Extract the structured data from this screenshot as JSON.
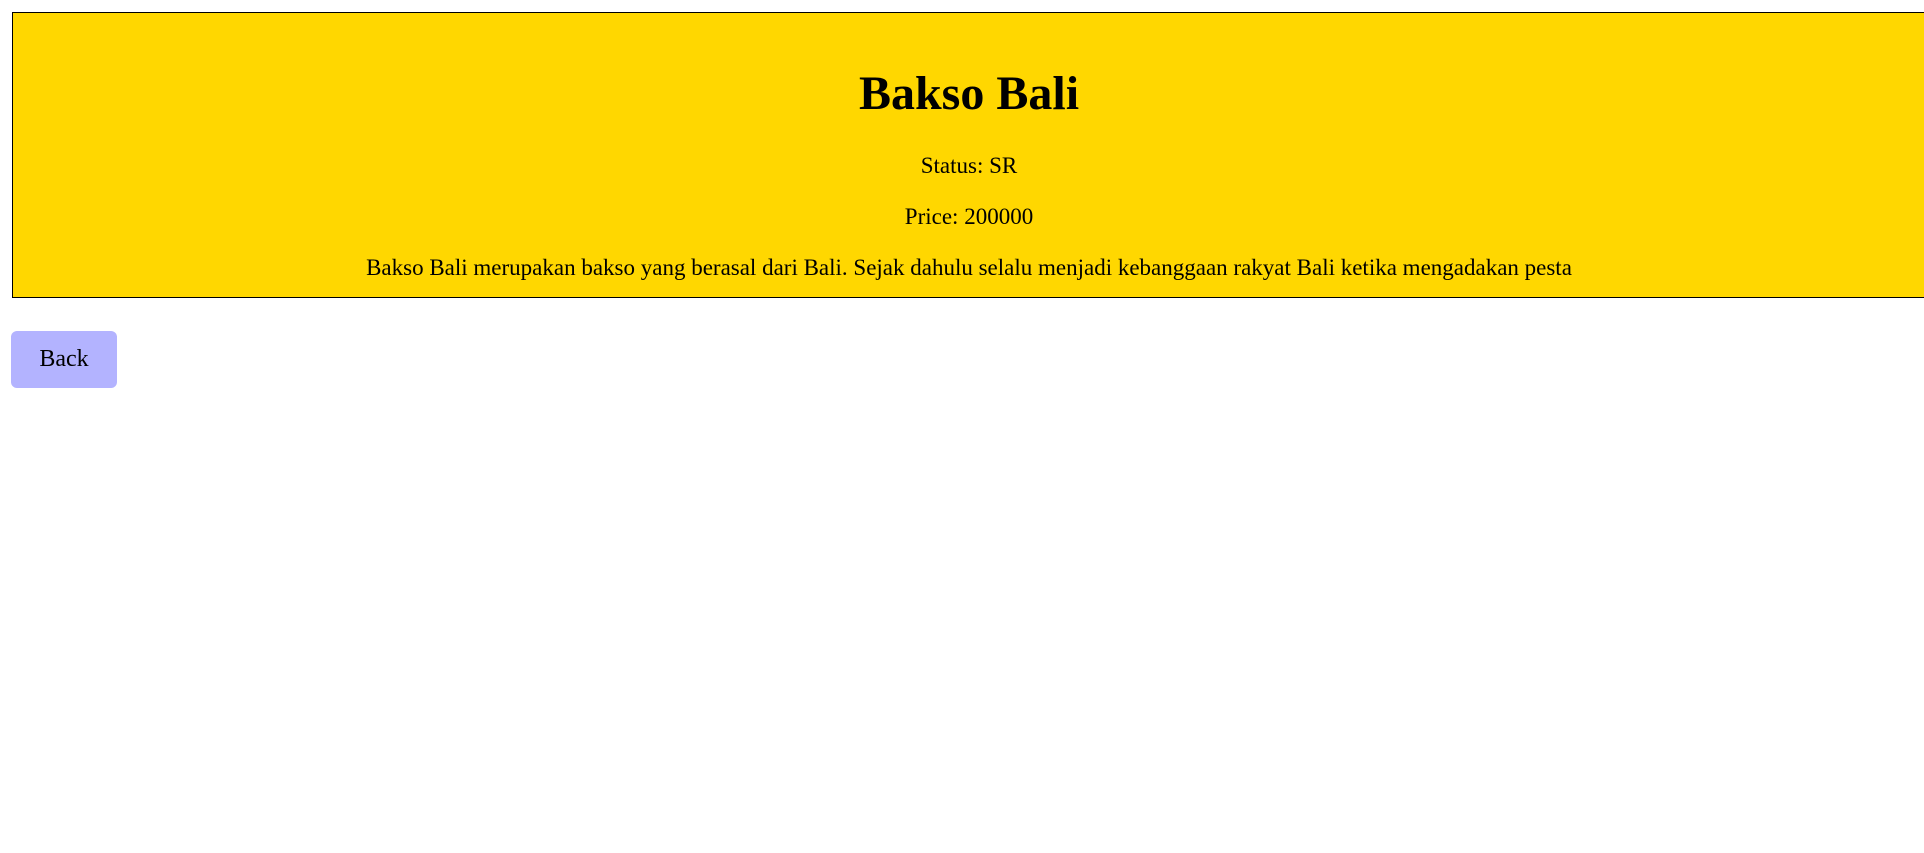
{
  "product": {
    "name": "Bakso Bali",
    "status_text": "Status: SR",
    "price_text": "Price: 200000",
    "description": "Bakso Bali merupakan bakso yang berasal dari Bali. Sejak dahulu selalu menjadi kebanggaan rakyat Bali ketika mengadakan pesta"
  },
  "actions": {
    "back_label": "Back"
  },
  "colors": {
    "card_background": "#ffd700",
    "button_background": "#b3b3ff",
    "text": "#000000"
  }
}
